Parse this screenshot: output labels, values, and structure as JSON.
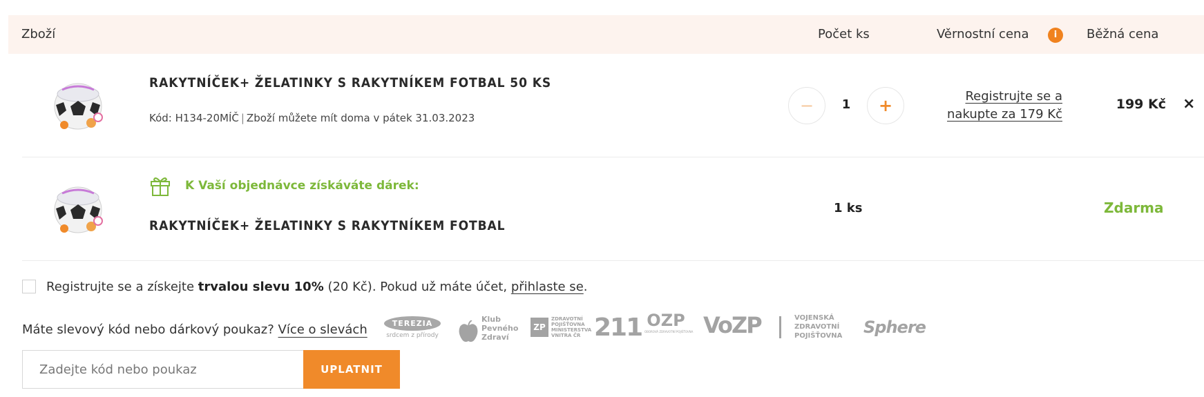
{
  "header": {
    "goods": "Zboží",
    "quantity": "Počet ks",
    "loyalty_price": "Věrnostní cena",
    "loyalty_info": "i",
    "regular_price": "Běžná cena"
  },
  "item": {
    "name": "RAKYTNÍČEK+ ŽELATINKY S RAKYTNÍKEM FOTBAL 50 KS",
    "code": "Kód: H134-20MÍČ",
    "separator": "|",
    "delivery": "Zboží můžete mít doma v pátek 31.03.2023",
    "qty_minus": "−",
    "qty_value": "1",
    "qty_plus": "+",
    "loyalty_line1": "Registrujte se a",
    "loyalty_line2": "nakupte za 179 Kč",
    "price": "199 Kč",
    "remove": "×"
  },
  "gift": {
    "note": "K Vaší objednávce získáváte dárek:",
    "name": "RAKYTNÍČEK+ ŽELATINKY S RAKYTNÍKEM FOTBAL",
    "qty": "1 ks",
    "price": "Zdarma"
  },
  "registration": {
    "text_before": "Registrujte se a získejte ",
    "bold": "trvalou slevu 10%",
    "text_mid": " (20 Kč). Pokud už máte účet, ",
    "link": "přihlaste se",
    "text_end": "."
  },
  "coupon": {
    "question": "Máte slevový kód nebo dárkový poukaz?",
    "link": "Více o slevách",
    "placeholder": "Zadejte kód nebo poukaz",
    "apply_label": "UPLATNIT"
  },
  "partners": {
    "terezia": "TEREZIA",
    "terezia_tag": "srdcem z přírody",
    "klub_line1": "Klub",
    "klub_line2": "Pevného",
    "klub_line3": "Zdraví",
    "zpmv_line1": "ZDRAVOTNÍ",
    "zpmv_line2": "POJIŠŤOVNA",
    "zpmv_line3": "MINISTERSTVA",
    "zpmv_line4": "VNITRA ČR",
    "zpmv_number": "211",
    "ozp": "OZP",
    "ozp_tag": "OBOROVÁ ZDRAVOTNÍ POJIŠŤOVNA",
    "vozp": "VoZP",
    "vojenska_line1": "VOJENSKÁ",
    "vojenska_line2": "ZDRAVOTNÍ",
    "vojenska_line3": "POJIŠŤOVNA",
    "sphere": "Sphere"
  },
  "colors": {
    "accent": "#f08a2a",
    "green": "#7db83a",
    "header_bg": "#fdf3ee"
  }
}
